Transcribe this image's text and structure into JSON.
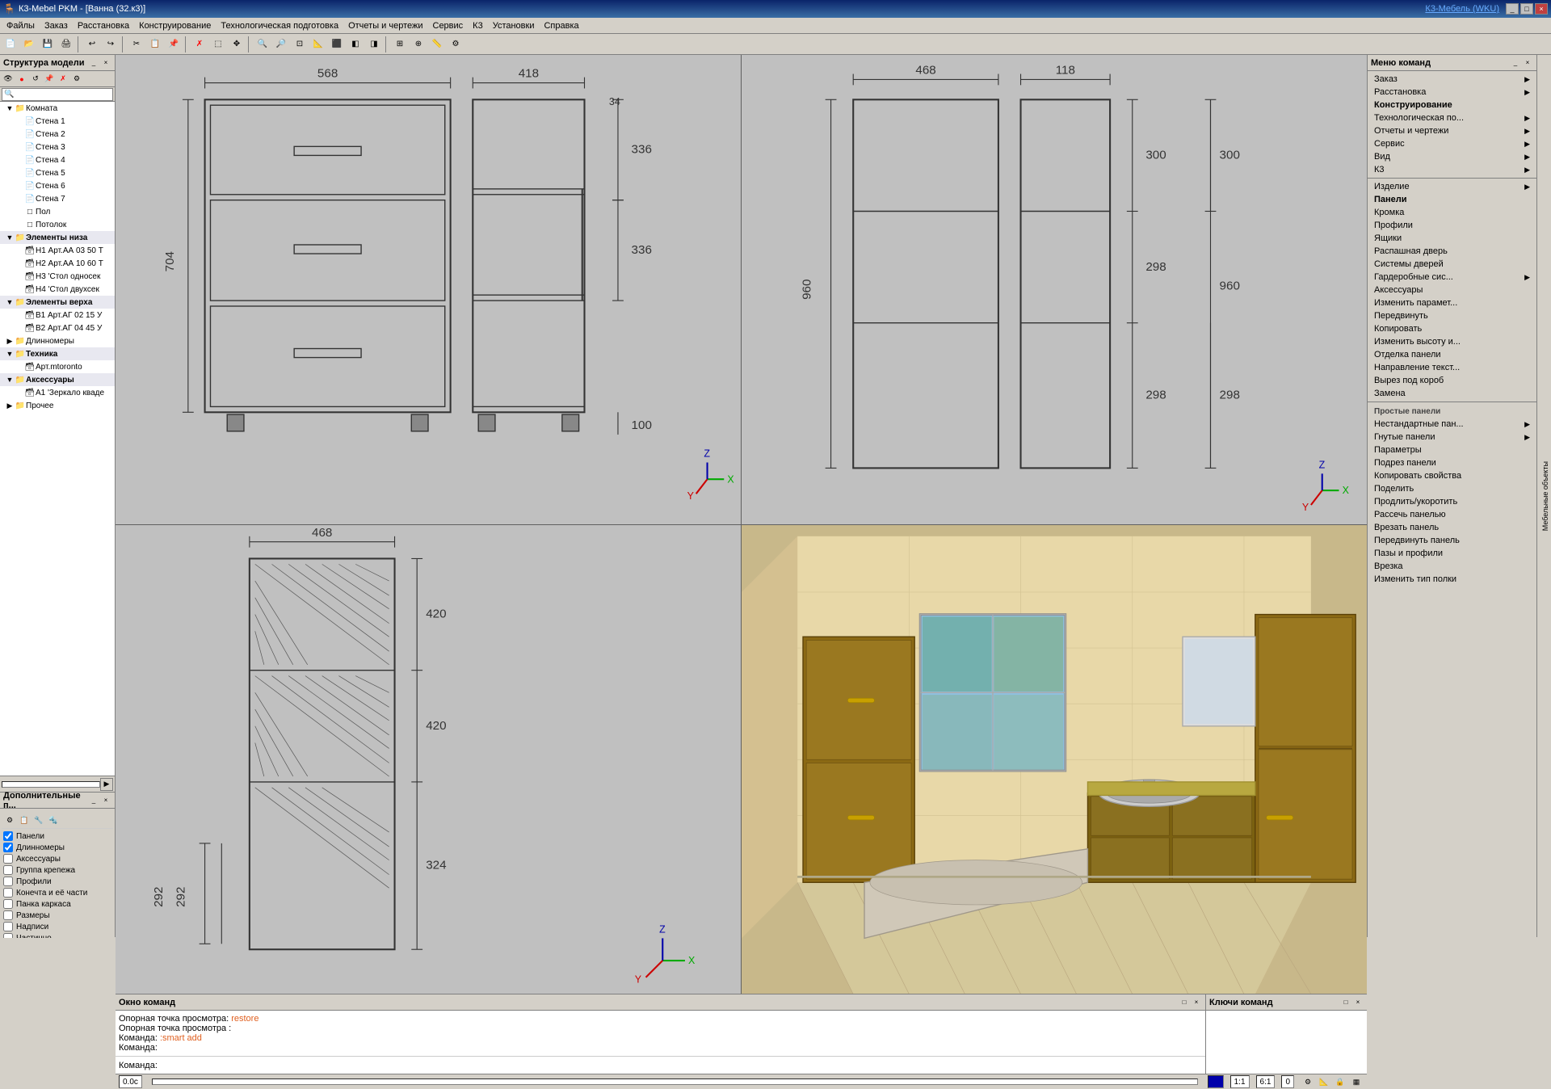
{
  "titlebar": {
    "title": "К3-Mebel PKM - [Ванна (32.к3)]",
    "link": "К3-Мебель (WKU)",
    "controls": [
      "_",
      "□",
      "×"
    ]
  },
  "menubar": {
    "items": [
      "Файлы",
      "Заказ",
      "Расстановка",
      "Конструирование",
      "Технологическая подготовка",
      "Отчеты и чертежи",
      "Сервис",
      "К3",
      "Установки",
      "Справка"
    ]
  },
  "structure_panel": {
    "title": "Структура модели",
    "tree": [
      {
        "label": "Комната",
        "level": 0,
        "type": "folder",
        "expanded": true
      },
      {
        "label": "Стена 1",
        "level": 1,
        "type": "wall"
      },
      {
        "label": "Стена 2",
        "level": 1,
        "type": "wall"
      },
      {
        "label": "Стена 3",
        "level": 1,
        "type": "wall"
      },
      {
        "label": "Стена 4",
        "level": 1,
        "type": "wall"
      },
      {
        "label": "Стена 5",
        "level": 1,
        "type": "wall"
      },
      {
        "label": "Стена 6",
        "level": 1,
        "type": "wall"
      },
      {
        "label": "Стена 7",
        "level": 1,
        "type": "wall"
      },
      {
        "label": "Пол",
        "level": 1,
        "type": "floor"
      },
      {
        "label": "Потолок",
        "level": 1,
        "type": "ceiling"
      },
      {
        "label": "Элементы низа",
        "level": 1,
        "type": "folder",
        "expanded": true
      },
      {
        "label": "Н1 Арт.АА 03 50 Т",
        "level": 2,
        "type": "item"
      },
      {
        "label": "Н2 Арт.АА 10 60 Т",
        "level": 2,
        "type": "item"
      },
      {
        "label": "Н3 'Стол односек",
        "level": 2,
        "type": "item"
      },
      {
        "label": "Н4 'Стол двухсек",
        "level": 2,
        "type": "item"
      },
      {
        "label": "Элементы верха",
        "level": 1,
        "type": "folder",
        "expanded": true
      },
      {
        "label": "В1 Арт.АГ 02 15 У",
        "level": 2,
        "type": "item"
      },
      {
        "label": "В2 Арт.АГ 04 45 У",
        "level": 2,
        "type": "item"
      },
      {
        "label": "Длинномеры",
        "level": 1,
        "type": "folder"
      },
      {
        "label": "Техника",
        "level": 1,
        "type": "folder",
        "expanded": true
      },
      {
        "label": "Арт.mtoronto",
        "level": 2,
        "type": "item"
      },
      {
        "label": "Аксессуары",
        "level": 1,
        "type": "folder",
        "expanded": true
      },
      {
        "label": "А1 'Зеркало кваде",
        "level": 2,
        "type": "item"
      },
      {
        "label": "Прочее",
        "level": 1,
        "type": "folder"
      }
    ]
  },
  "additional_panel": {
    "title": "Дополнительные п...",
    "items": [
      {
        "label": "Панели",
        "checked": true
      },
      {
        "label": "Длинномеры",
        "checked": true
      },
      {
        "label": "Аксессуары",
        "checked": false
      },
      {
        "label": "Группа крепежа",
        "checked": false
      },
      {
        "label": "Профили",
        "checked": false
      },
      {
        "label": "Конечта и её части",
        "checked": false
      },
      {
        "label": "Панка каркаса",
        "checked": false
      },
      {
        "label": "Размеры",
        "checked": false
      },
      {
        "label": "Надписи",
        "checked": false
      },
      {
        "label": "Частично",
        "checked": false
      }
    ]
  },
  "viewports": {
    "top_left_dims": {
      "w": "568",
      "h1": "704",
      "h2": "336",
      "h3": "336",
      "h4": "100",
      "w2": "418",
      "w3": "34"
    },
    "top_right_dims": {
      "w": "468",
      "w2": "118",
      "h": "960",
      "h2": "298",
      "h3": "298",
      "h4": "300",
      "w3": "300"
    },
    "bottom_left_dims": {
      "w": "468",
      "h1": "420",
      "h2": "420",
      "h3": "324",
      "h4": "292",
      "h5": "292"
    }
  },
  "command_window": {
    "title": "Окно команд",
    "lines": [
      {
        "text": "Опорная точка просмотра: restore",
        "highlight": true
      },
      {
        "text": "Опорная точка просмотра :",
        "highlight": false
      },
      {
        "text": "Команда: :smart add",
        "highlight": true
      },
      {
        "text": "Команда:",
        "highlight": false
      }
    ],
    "input_label": "Команда:"
  },
  "keys_window": {
    "title": "Ключи команд"
  },
  "statusbar": {
    "coord": "0.0с",
    "scale1": "1:1",
    "scale2": "6:1",
    "value": "0"
  },
  "right_panel": {
    "title": "Меню команд",
    "sections": [
      {
        "items": [
          {
            "label": "Заказ",
            "arrow": true
          },
          {
            "label": "Расстановка",
            "arrow": true
          },
          {
            "label": "Конструирование",
            "arrow": false,
            "bold": true
          },
          {
            "label": "Технологическая по...",
            "arrow": true
          },
          {
            "label": "Отчеты и чертежи",
            "arrow": true
          },
          {
            "label": "Сервис",
            "arrow": true
          },
          {
            "label": "Вид",
            "arrow": true
          },
          {
            "label": "К3",
            "arrow": true
          }
        ]
      },
      {
        "separator": true
      },
      {
        "items": [
          {
            "label": "Изделие",
            "arrow": true
          },
          {
            "label": "Панели",
            "arrow": false,
            "bold": true
          },
          {
            "label": "Кромка",
            "arrow": false
          },
          {
            "label": "Профили",
            "arrow": false
          },
          {
            "label": "Ящики",
            "arrow": false
          },
          {
            "label": "Распашная дверь",
            "arrow": false
          },
          {
            "label": "Системы дверей",
            "arrow": false
          },
          {
            "label": "Гардеробные сис...",
            "arrow": true
          },
          {
            "label": "Аксессуары",
            "arrow": false
          },
          {
            "label": "Изменить парамет...",
            "arrow": false
          },
          {
            "label": "Передвинуть",
            "arrow": false
          },
          {
            "label": "Копировать",
            "arrow": false
          },
          {
            "label": "Изменить высоту и...",
            "arrow": false
          },
          {
            "label": "Отделка панели",
            "arrow": false
          },
          {
            "label": "Направление текст...",
            "arrow": false
          },
          {
            "label": "Вырез под короб",
            "arrow": false
          },
          {
            "label": "Замена",
            "arrow": false
          }
        ]
      },
      {
        "separator": true
      },
      {
        "header": "Простые панели",
        "items": [
          {
            "label": "Нестандартные пан...",
            "arrow": true
          },
          {
            "label": "Гнутые панели",
            "arrow": true
          },
          {
            "label": "Параметры",
            "arrow": false
          },
          {
            "label": "Подрез панели",
            "arrow": false
          },
          {
            "label": "Копировать свойства",
            "arrow": false
          },
          {
            "label": "Поделить",
            "arrow": false
          },
          {
            "label": "Продлить/укоротить",
            "arrow": false
          },
          {
            "label": "Рассечь панелью",
            "arrow": false
          },
          {
            "label": "Врезать панель",
            "arrow": false
          },
          {
            "label": "Передвинуть панель",
            "arrow": false
          },
          {
            "label": "Пазы и профили",
            "arrow": false
          },
          {
            "label": "Врезка",
            "arrow": false
          },
          {
            "label": "Изменить тип полки",
            "arrow": false
          }
        ]
      }
    ]
  },
  "side_text": "Мебельные объекты"
}
